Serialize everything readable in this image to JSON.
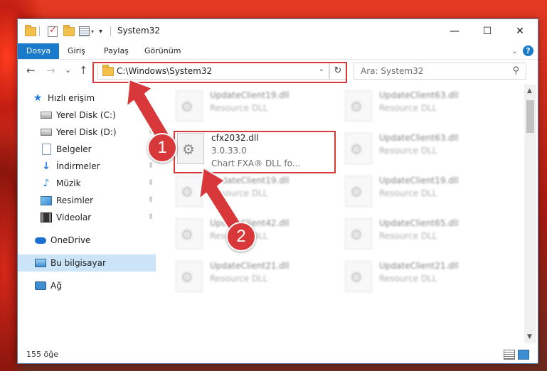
{
  "window": {
    "title": "System32"
  },
  "caption": {
    "minimize": "—",
    "maximize": "☐",
    "close": "✕"
  },
  "ribbon": {
    "tabs": [
      "Dosya",
      "Giriş",
      "Paylaş",
      "Görünüm"
    ],
    "help": "?"
  },
  "nav": {
    "back": "←",
    "forward": "→",
    "recent": "⌄",
    "up": "↑",
    "address": "C:\\Windows\\System32",
    "refresh": "↻",
    "search_placeholder": "Ara: System32"
  },
  "sidebar": {
    "quick_access": "Hızlı erişim",
    "items": [
      "Yerel Disk (C:)",
      "Yerel Disk (D:)",
      "Belgeler",
      "İndirmeler",
      "Müzik",
      "Resimler",
      "Videolar"
    ],
    "onedrive": "OneDrive",
    "this_pc": "Bu bilgisayar",
    "network": "Ağ"
  },
  "files": {
    "selected": {
      "name": "cfx2032.dll",
      "version": "3.0.33.0",
      "desc": "Chart FXA® DLL fo..."
    },
    "blurred_left": [
      {
        "name": "UpdateClient19.dll",
        "desc": "Resource DLL"
      },
      {
        "name": "UpdateClient19.dll",
        "desc": "Resource DLL"
      },
      {
        "name": "UpdateClient42.dll",
        "desc": "Resource DLL"
      },
      {
        "name": "UpdateClient21.dll",
        "desc": "Resource DLL"
      }
    ],
    "blurred_right": [
      {
        "name": "UpdateClient63.dll",
        "desc": "Resource DLL"
      },
      {
        "name": "UpdateClient63.dll",
        "desc": "Resource DLL"
      },
      {
        "name": "UpdateClient19.dll",
        "desc": "Resource DLL"
      },
      {
        "name": "UpdateClient65.dll",
        "desc": "Resource DLL"
      },
      {
        "name": "UpdateClient21.dll",
        "desc": "Resource DLL"
      }
    ]
  },
  "status": {
    "count": "155 öğe"
  },
  "annotations": {
    "step1": "1",
    "step2": "2",
    "accent": "#d9383a"
  }
}
